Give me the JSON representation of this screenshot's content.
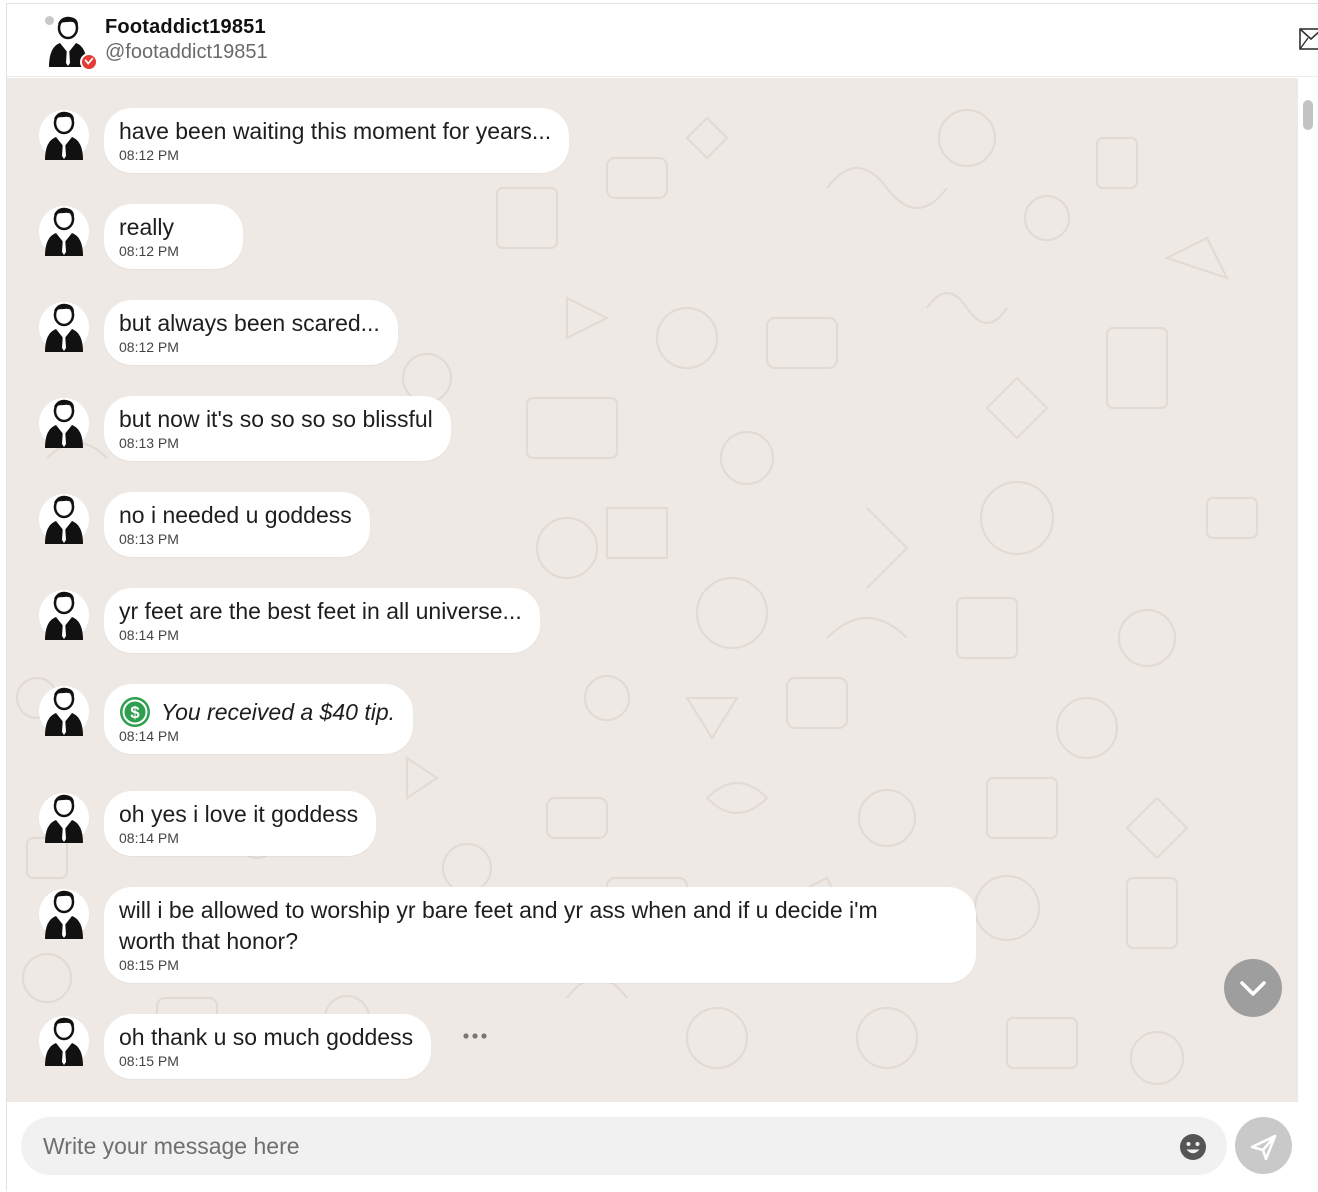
{
  "header": {
    "name": "Footaddict19851",
    "handle": "@footaddict19851"
  },
  "messages": [
    {
      "text": "have been waiting this moment for years...",
      "time": "08:12 PM"
    },
    {
      "text": "really",
      "time": "08:12 PM"
    },
    {
      "text": "but always been scared...",
      "time": "08:12 PM"
    },
    {
      "text": "but now it's so so so so blissful",
      "time": "08:13 PM"
    },
    {
      "text": "no i needed u goddess",
      "time": "08:13 PM"
    },
    {
      "text": "yr feet are the best feet in all universe...",
      "time": "08:14 PM"
    },
    {
      "text": "You received a $40 tip.",
      "time": "08:14 PM",
      "type": "tip"
    },
    {
      "text": "oh yes i love it goddess",
      "time": "08:14 PM"
    },
    {
      "text": "will i be allowed to worship yr bare feet and yr ass when and if u decide i'm worth that honor?",
      "time": "08:15 PM"
    },
    {
      "text": "oh thank u so much goddess",
      "time": "08:15 PM"
    }
  ],
  "composer": {
    "placeholder": "Write your message here"
  },
  "icons": {
    "mail": "envelope-icon",
    "emoji": "smiley-icon",
    "send": "paper-plane-icon",
    "scroll_down": "chevron-down-icon",
    "tip": "dollar-coin-icon"
  },
  "colors": {
    "chat_background": "#efe9e5",
    "bubble": "#ffffff",
    "tip_green": "#2e9e4f",
    "badge_red": "#e53935"
  }
}
